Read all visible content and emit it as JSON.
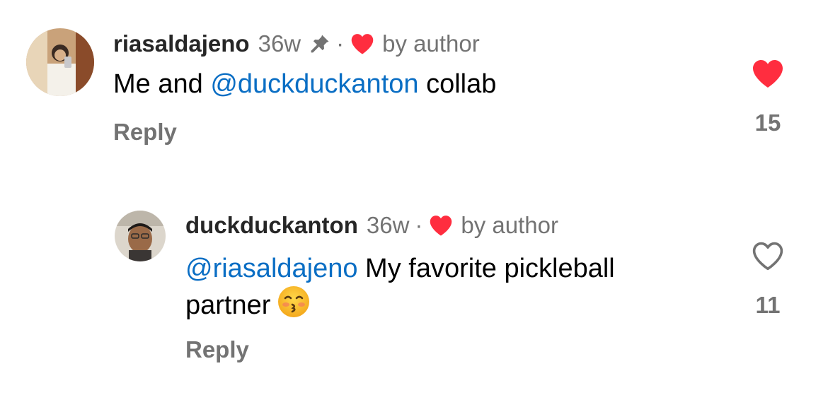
{
  "comments": [
    {
      "username": "riasaldajeno",
      "time": "36w",
      "separator": "·",
      "by_author": "by author",
      "pinned": true,
      "text_prefix": "Me and ",
      "mention": "@duckduckanton",
      "text_suffix": " collab",
      "reply_label": "Reply",
      "like_count": "15",
      "liked": true,
      "like_color": "#ff2d3f"
    },
    {
      "username": "duckduckanton",
      "time": "36w",
      "separator": "·",
      "by_author": "by author",
      "pinned": false,
      "mention": "@riasaldajeno",
      "text_line1_suffix": " My favorite pickleball",
      "text_line2": "partner",
      "emoji": "kissing-face-smiling-eyes",
      "reply_label": "Reply",
      "like_count": "11",
      "liked": false
    }
  ],
  "colors": {
    "mention": "#0a6ec4",
    "secondary_text": "#737373",
    "heart_red": "#ff2d3f",
    "outline_gray": "#737373"
  }
}
